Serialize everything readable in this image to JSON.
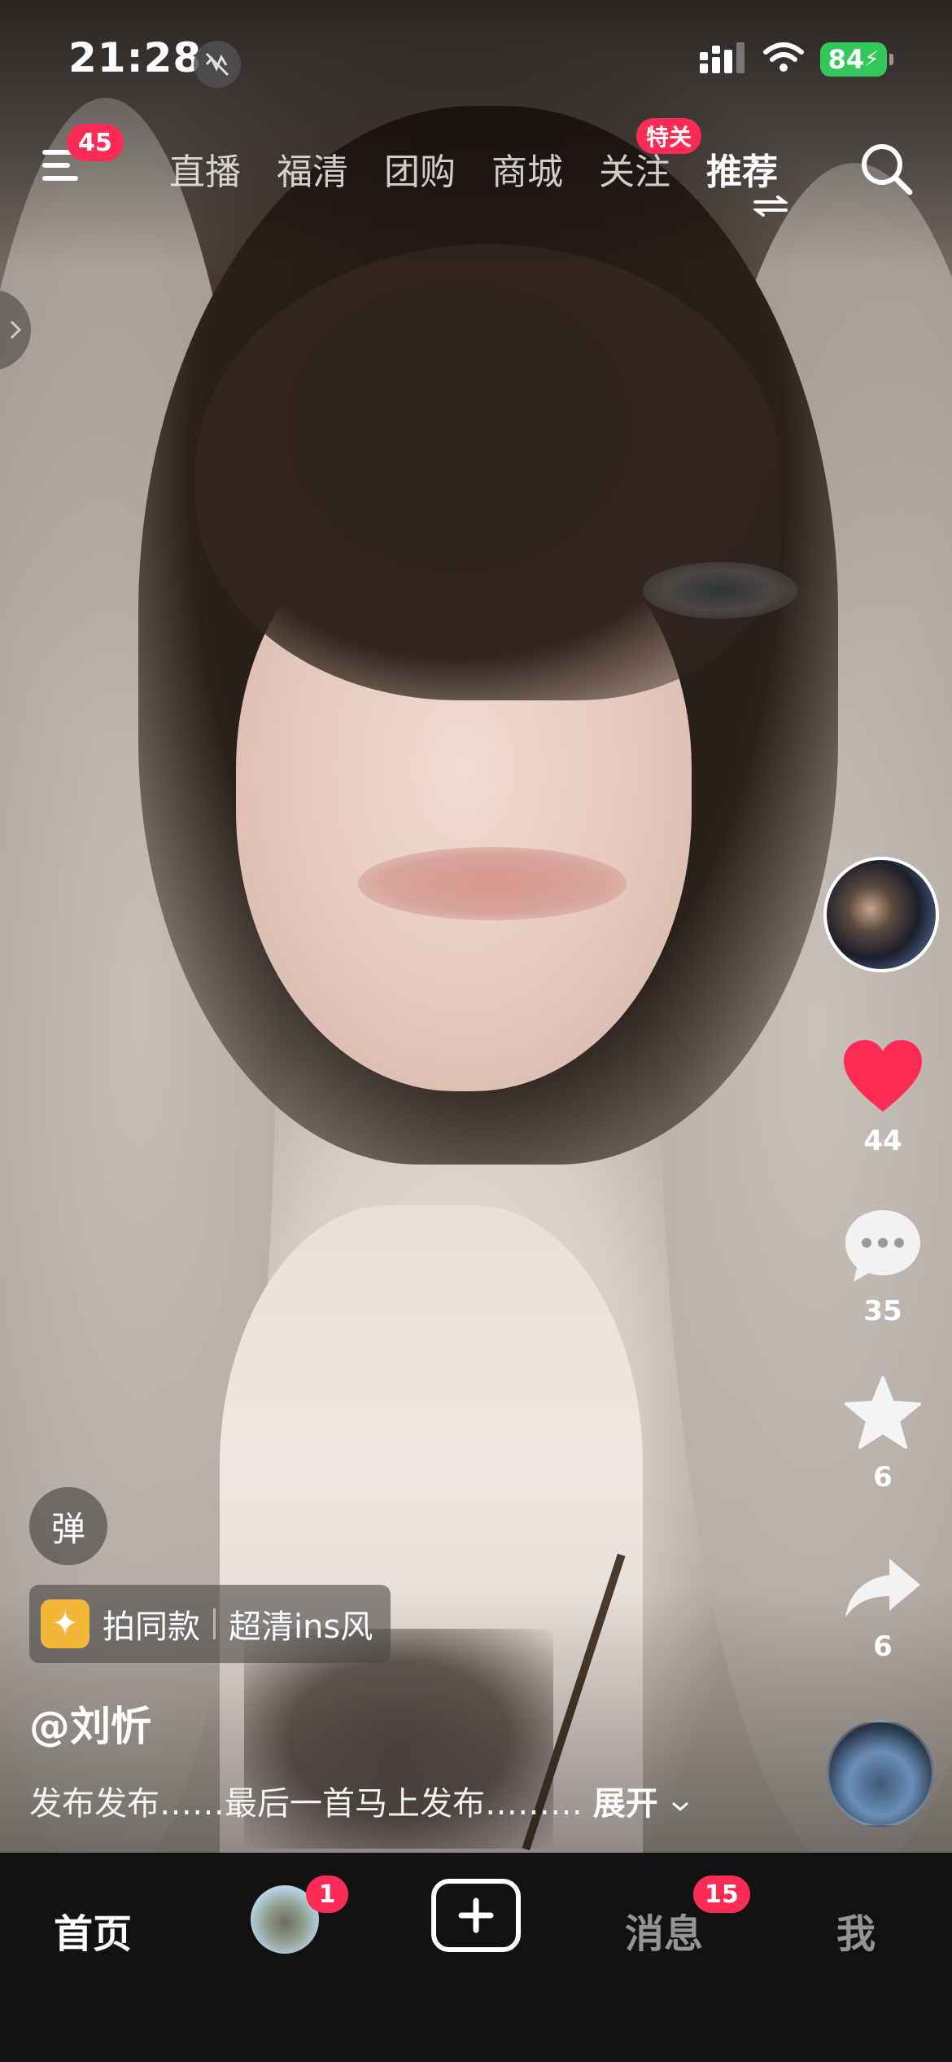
{
  "status_bar": {
    "time": "21:28",
    "battery": "84",
    "icons": [
      "dnd-icon",
      "signal-icon",
      "wifi-icon",
      "battery-icon"
    ]
  },
  "top_nav": {
    "menu_badge": "45",
    "tabs": [
      {
        "label": "直播"
      },
      {
        "label": "福清"
      },
      {
        "label": "团购"
      },
      {
        "label": "商城"
      },
      {
        "label": "关注",
        "badge": "特关"
      },
      {
        "label": "推荐",
        "active": true
      }
    ]
  },
  "video": {
    "danmu_label": "弹",
    "tag_chip": {
      "left": "拍同款",
      "right": "超清ins风"
    },
    "author": "@刘忻",
    "description": "发布发布……最后一首马上发布………",
    "expand_label": "展开"
  },
  "actions": {
    "likes": "44",
    "comments": "35",
    "favorites": "6",
    "shares": "6"
  },
  "bottom_tabs": {
    "home": "首页",
    "friends_badge": "1",
    "messages": "消息",
    "messages_badge": "15",
    "me": "我"
  },
  "colors": {
    "accent_red": "#fe2c55",
    "battery_green": "#34c759",
    "tabbar_bg": "#121212"
  }
}
